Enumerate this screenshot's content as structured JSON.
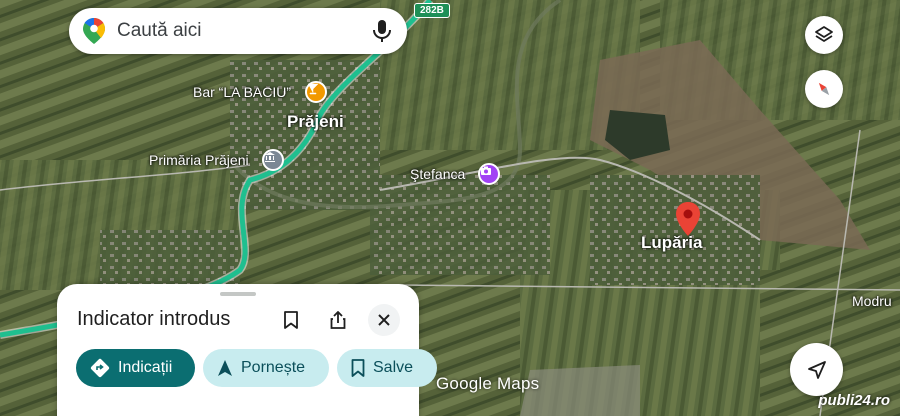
{
  "search": {
    "placeholder": "Caută aici"
  },
  "road_badge": "282B",
  "places": {
    "bar": "Bar “LA BACIU”",
    "prajeni": "Prăjeni",
    "primaria": "Primăria Prăjeni",
    "stefanca": "Ştefanca",
    "luparia": "Lupăria",
    "modru": "Modru"
  },
  "sheet": {
    "title": "Indicator introdus",
    "chips": {
      "directions": "Indicații",
      "start": "Pornește",
      "save": "Salve"
    }
  },
  "map_attribution": "Google Maps",
  "watermark": "publi24.ro",
  "colors": {
    "route": "#1fbf8f",
    "pin": "#ea4335",
    "chip_primary": "#0b6e71",
    "chip_secondary": "#c8ecef",
    "bar_icon": "#f29900",
    "primaria_icon": "#7b8794",
    "stefanca_icon": "#a142f4"
  },
  "icons": {
    "maps_logo": "google-maps-pin-logo",
    "mic": "microphone-icon",
    "layers": "layers-icon",
    "compass": "compass-icon",
    "bookmark": "bookmark-icon",
    "share": "share-icon",
    "close": "close-icon",
    "directions": "directions-diamond-icon",
    "navigate": "navigation-arrow-icon",
    "my_location": "location-arrow-icon"
  }
}
